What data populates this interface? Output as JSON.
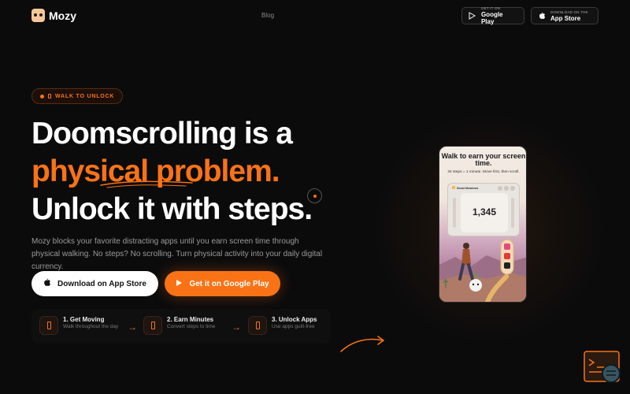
{
  "header": {
    "brand_name": "Mozy",
    "nav_link": "Blog",
    "google_badge": {
      "small": "GET IT ON",
      "big": "Google Play"
    },
    "apple_badge": {
      "small": "DOWNLOAD ON THE",
      "big": "App Store"
    }
  },
  "hero": {
    "pill_label": "WALK TO UNLOCK",
    "headline_line1": "Doomscrolling is a",
    "headline_line2": "physical problem.",
    "headline_line3": "Unlock it with steps.",
    "description": "Mozy blocks your favorite distracting apps until you earn screen time through physical walking. No steps? No scrolling. Turn physical activity into your daily digital currency.",
    "cta_app_store": "Download on App Store",
    "cta_google_play": "Get it on Google Play"
  },
  "steps": [
    {
      "title": "1. Get Moving",
      "subtitle": "Walk throughout the day"
    },
    {
      "title": "2. Earn Minutes",
      "subtitle": "Convert steps to time"
    },
    {
      "title": "3. Unlock Apps",
      "subtitle": "Use apps guilt-free"
    }
  ],
  "phone": {
    "title": "Walk to earn your screen time.",
    "subtitle": "34 steps = 1 minute. Move first, then scroll.",
    "card_header": "Smart Meadows",
    "step_count": "1,345"
  },
  "colors": {
    "accent": "#f97316",
    "background": "#0b0b0c"
  }
}
